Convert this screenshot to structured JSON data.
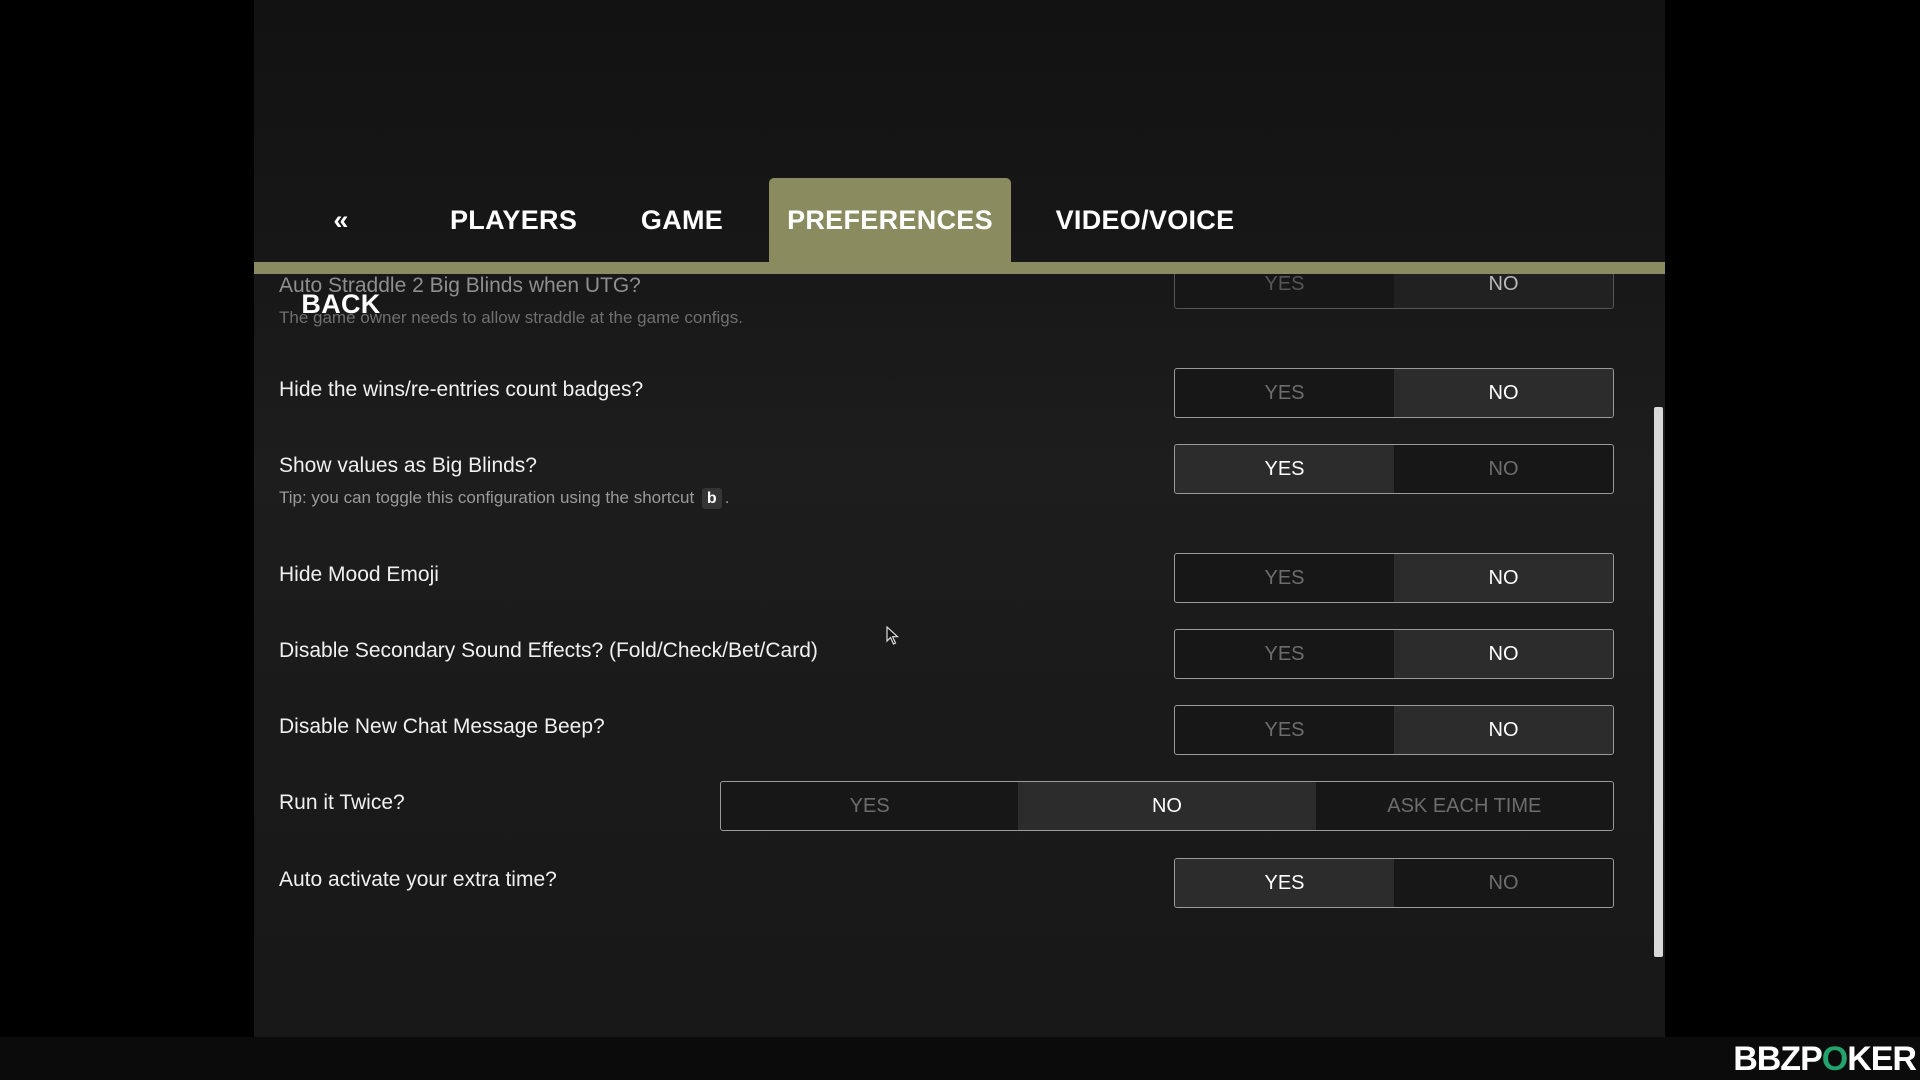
{
  "tabs": [
    {
      "label": "« BACK"
    },
    {
      "label": "PLAYERS"
    },
    {
      "label": "GAME"
    },
    {
      "label": "PREFERENCES",
      "active": true
    },
    {
      "label": "VIDEO/VOICE"
    }
  ],
  "settings": [
    {
      "question": "Auto Straddle 2 Big Blinds when UTG?",
      "hint": "The game owner needs to allow straddle at the game configs.",
      "options": [
        "YES",
        "NO"
      ],
      "selected": "NO"
    },
    {
      "question": "Hide the wins/re-entries count badges?",
      "options": [
        "YES",
        "NO"
      ],
      "selected": "NO"
    },
    {
      "question": "Show values as Big Blinds?",
      "hint_prefix": "Tip: you can toggle this configuration using the shortcut",
      "hint_key": "b",
      "hint_suffix": ".",
      "options": [
        "YES",
        "NO"
      ],
      "selected": "YES"
    },
    {
      "question": "Hide Mood Emoji",
      "options": [
        "YES",
        "NO"
      ],
      "selected": "NO"
    },
    {
      "question": "Disable Secondary Sound Effects? (Fold/Check/Bet/Card)",
      "options": [
        "YES",
        "NO"
      ],
      "selected": "NO"
    },
    {
      "question": "Disable New Chat Message Beep?",
      "options": [
        "YES",
        "NO"
      ],
      "selected": "NO"
    },
    {
      "question": "Run it Twice?",
      "options": [
        "YES",
        "NO",
        "ASK EACH TIME"
      ],
      "selected": "NO"
    },
    {
      "question": "Auto activate your extra time?",
      "options": [
        "YES",
        "NO"
      ],
      "selected": "YES"
    }
  ],
  "logo": {
    "part1": "BBZP",
    "part2": "O",
    "part3": "KER"
  },
  "colors": {
    "accent": "#8a8c5f",
    "logo_green": "#23a36b",
    "background": "#000000"
  }
}
